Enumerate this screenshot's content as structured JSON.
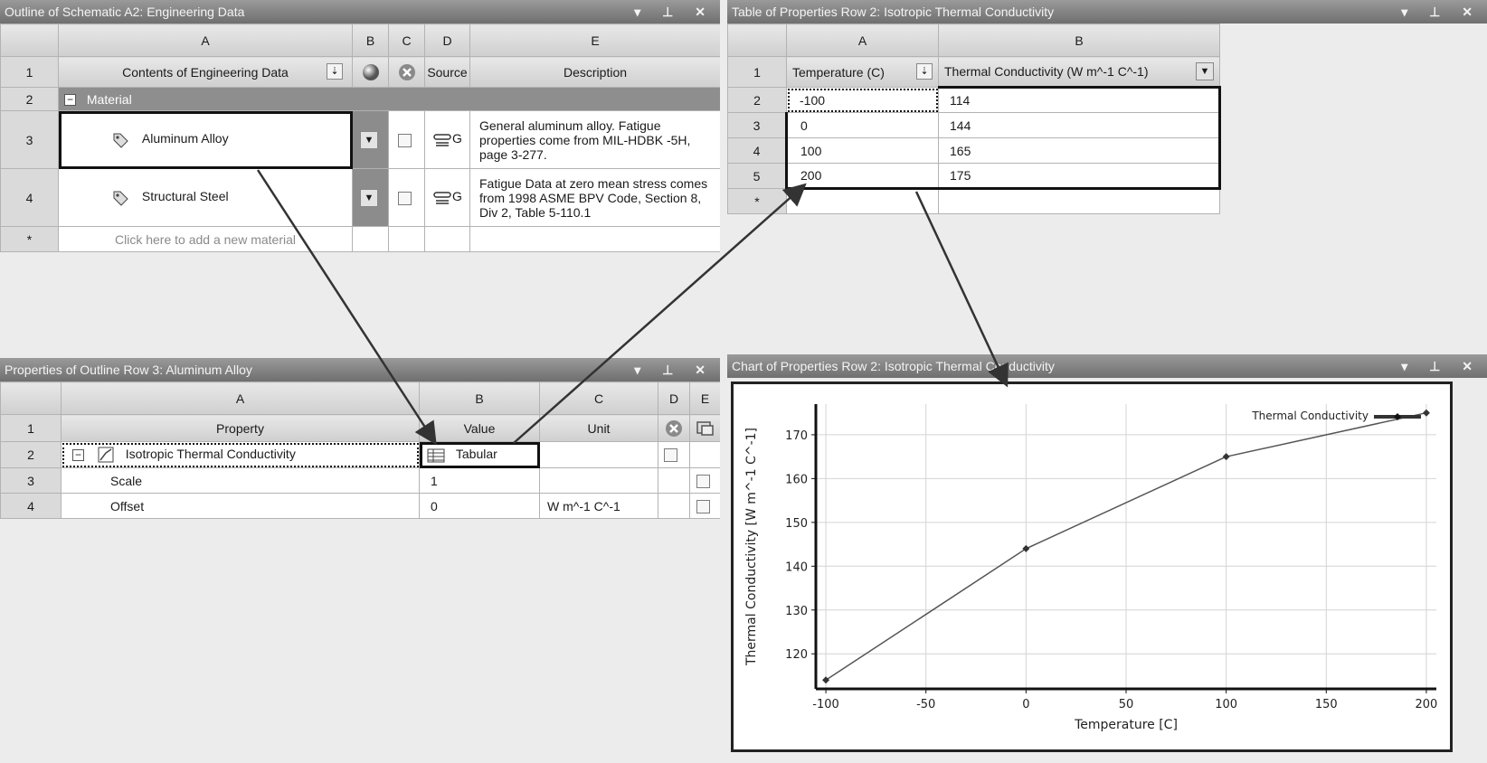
{
  "outline_panel": {
    "title": "Outline of Schematic A2: Engineering Data",
    "controls": "▾ ⊥ ✕",
    "col_headers": [
      "",
      "A",
      "B",
      "C",
      "D",
      "E"
    ],
    "header_row": {
      "num": "1",
      "contents": "Contents of Engineering Data",
      "source": "Source",
      "description": "Description"
    },
    "group": {
      "num": "2",
      "label": "Material"
    },
    "materials": [
      {
        "num": "3",
        "name": "Aluminum Alloy",
        "source_char": "G",
        "description": "General aluminum alloy. Fatigue properties come from MIL-HDBK -5H, page 3-277."
      },
      {
        "num": "4",
        "name": "Structural Steel",
        "source_char": "G",
        "description": "Fatigue Data at zero mean stress comes from 1998 ASME BPV Code, Section 8, Div 2, Table 5-110.1"
      }
    ],
    "new_row": {
      "num": "*",
      "placeholder": "Click here to add a new material"
    }
  },
  "properties_panel": {
    "title": "Properties of Outline Row 3: Aluminum Alloy",
    "controls": "▾ ⊥ ✕",
    "col_headers": [
      "",
      "A",
      "B",
      "C",
      "D",
      "E"
    ],
    "header_row": {
      "num": "1",
      "property": "Property",
      "value": "Value",
      "unit": "Unit"
    },
    "rows": [
      {
        "num": "2",
        "property": "Isotropic Thermal Conductivity",
        "value": "Tabular",
        "unit": ""
      },
      {
        "num": "3",
        "property": "Scale",
        "value": "1",
        "unit": ""
      },
      {
        "num": "4",
        "property": "Offset",
        "value": "0",
        "unit": "W m^-1 C^-1"
      }
    ]
  },
  "table_panel": {
    "title": "Table of Properties Row 2: Isotropic Thermal Conductivity",
    "controls": "▾ ⊥ ✕",
    "col_headers": [
      "",
      "A",
      "B"
    ],
    "header_row": {
      "num": "1",
      "temp": "Temperature (C)",
      "cond": "Thermal Conductivity (W m^-1 C^-1)"
    },
    "rows": [
      {
        "num": "2",
        "temp": "-100",
        "cond": "114"
      },
      {
        "num": "3",
        "temp": "0",
        "cond": "144"
      },
      {
        "num": "4",
        "temp": "100",
        "cond": "165"
      },
      {
        "num": "5",
        "temp": "200",
        "cond": "175"
      }
    ],
    "new_row": {
      "num": "*"
    }
  },
  "chart_panel": {
    "title": "Chart of Properties Row 2: Isotropic Thermal Conductivity",
    "controls": "▾ ⊥ ✕"
  },
  "chart_data": {
    "type": "line",
    "xlabel": "Temperature  [C]",
    "ylabel": "Thermal Conductivity  [W m^-1 C^-1]",
    "xlim": [
      -105,
      205
    ],
    "ylim": [
      112,
      177
    ],
    "xticks": [
      -100,
      -50,
      0,
      50,
      100,
      150,
      200
    ],
    "yticks": [
      120,
      130,
      140,
      150,
      160,
      170
    ],
    "grid": true,
    "legend_position": "top-right",
    "series": [
      {
        "name": "Thermal Conductivity",
        "x": [
          -100,
          0,
          100,
          200
        ],
        "y": [
          114,
          144,
          165,
          175
        ]
      }
    ]
  },
  "colors": {
    "line": "#555555",
    "title_bar": "#7a7a7a",
    "group_row": "#8e8e8e"
  }
}
